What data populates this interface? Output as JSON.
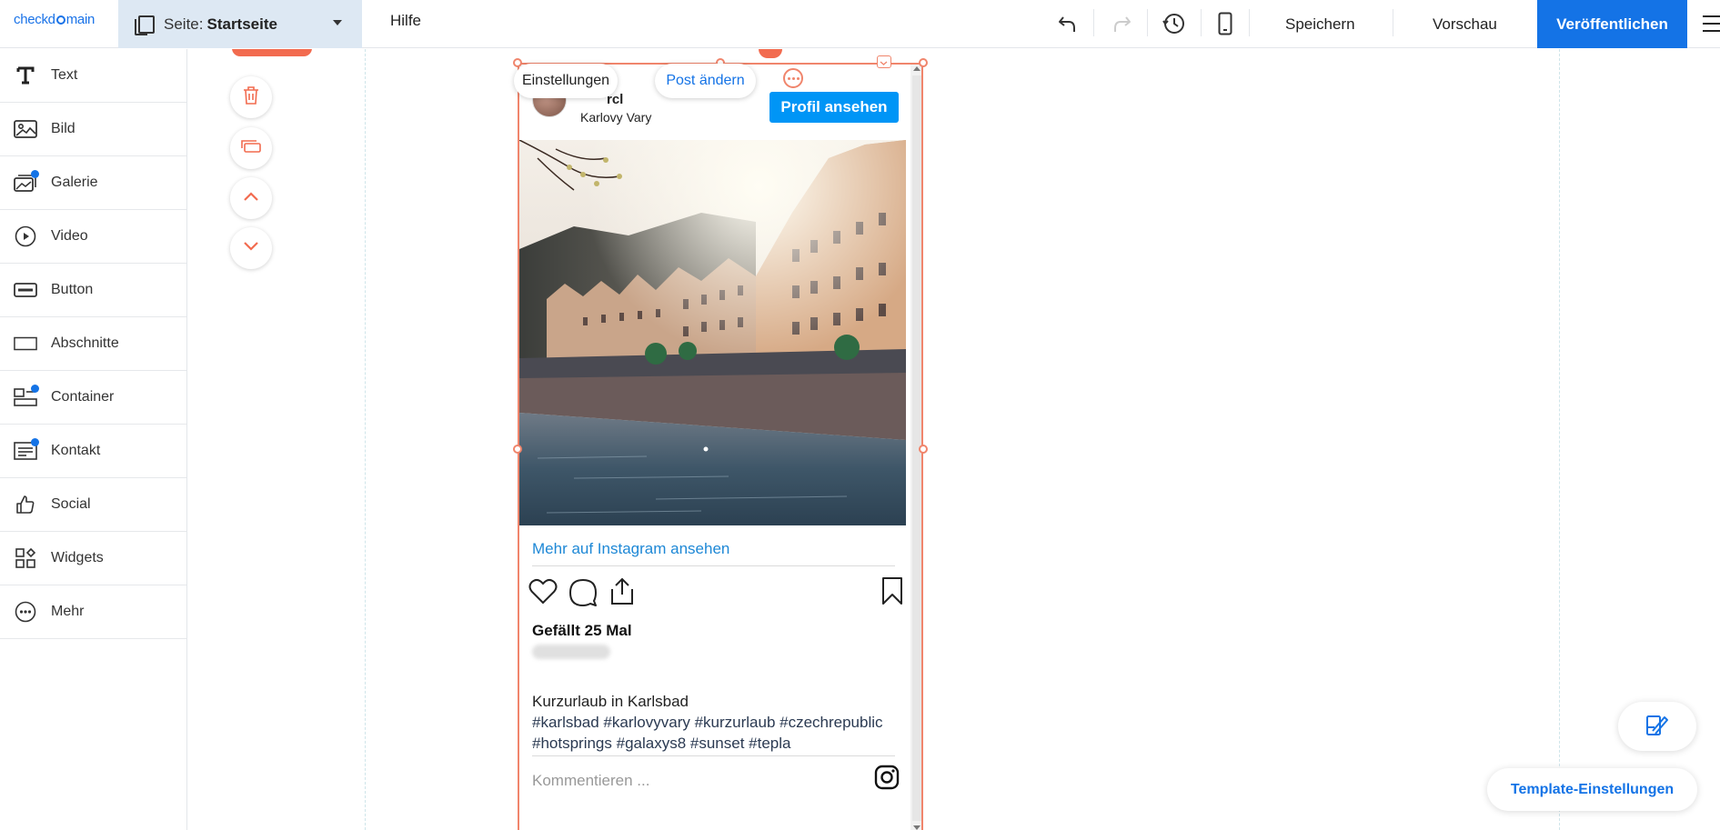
{
  "app": {
    "logo_text_a": "checkd",
    "logo_text_b": "main"
  },
  "topbar": {
    "page_prefix": "Seite:",
    "page_name": "Startseite",
    "help_label": "Hilfe",
    "save_label": "Speichern",
    "preview_label": "Vorschau",
    "publish_label": "Veröffentlichen",
    "icons": [
      "undo-icon",
      "redo-icon",
      "history-icon",
      "mobile-preview-icon",
      "menu-icon"
    ]
  },
  "sidebar": {
    "items": [
      {
        "label": "Text",
        "icon": "text-icon",
        "badge": false
      },
      {
        "label": "Bild",
        "icon": "image-icon",
        "badge": false
      },
      {
        "label": "Galerie",
        "icon": "gallery-icon",
        "badge": true
      },
      {
        "label": "Video",
        "icon": "video-icon",
        "badge": false
      },
      {
        "label": "Button",
        "icon": "button-icon",
        "badge": false
      },
      {
        "label": "Abschnitte",
        "icon": "section-icon",
        "badge": false
      },
      {
        "label": "Container",
        "icon": "container-icon",
        "badge": true
      },
      {
        "label": "Kontakt",
        "icon": "contact-icon",
        "badge": true
      },
      {
        "label": "Social",
        "icon": "thumbs-up-icon",
        "badge": false
      },
      {
        "label": "Widgets",
        "icon": "widgets-icon",
        "badge": false
      },
      {
        "label": "Mehr",
        "icon": "more-icon",
        "badge": false
      }
    ]
  },
  "canvas": {
    "tools": [
      "trash-icon",
      "duplicate-icon",
      "move-up-icon",
      "move-down-icon"
    ],
    "context_menu": {
      "settings_label": "Einstellungen",
      "edit_post_label": "Post ändern"
    }
  },
  "instagram": {
    "username_partial": "rcl",
    "location": "Karlovy Vary",
    "profile_button": "Profil ansehen",
    "more_link": "Mehr auf Instagram ansehen",
    "likes": "Gefällt 25 Mal",
    "caption_line1": "Kurzurlaub in Karlsbad",
    "caption_tags": "#karlsbad #karlovyvary #kurzurlaub #czechrepublic #hotsprings #galaxys8 #sunset #tepla",
    "comment_placeholder": "Kommentieren ..."
  },
  "floating": {
    "template_settings_label": "Template-Einstellungen"
  },
  "colors": {
    "accent": "#1473e6",
    "selection": "#f0856c",
    "instagram_blue": "#0095f6"
  }
}
